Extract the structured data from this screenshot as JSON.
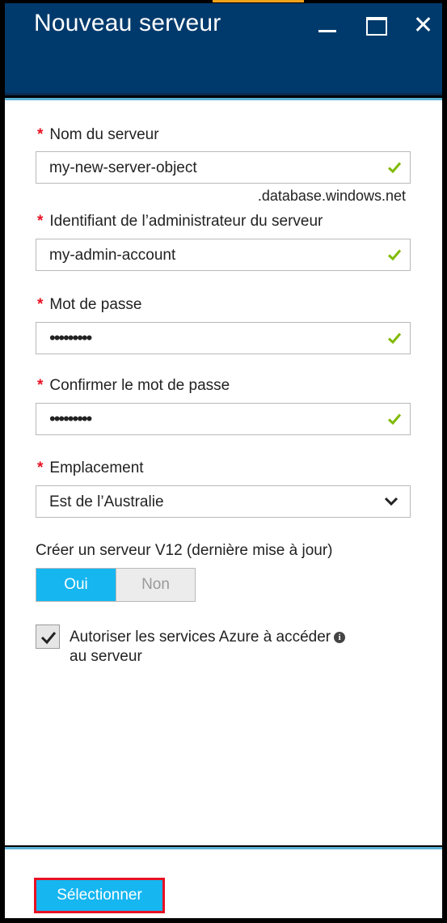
{
  "window": {
    "title": "Nouveau serveur"
  },
  "form": {
    "required_mark": "*",
    "server_name": {
      "label": "Nom du serveur",
      "value": "my-new-server-object",
      "suffix": ".database.windows.net"
    },
    "admin_login": {
      "label": "Identifiant de l’administrateur du serveur",
      "value": "my-admin-account"
    },
    "password": {
      "label": "Mot de passe",
      "value": "•••••••••"
    },
    "confirm_password": {
      "label": "Confirmer le mot de passe",
      "value": "•••••••••"
    },
    "location": {
      "label": "Emplacement",
      "value": "Est de l’Australie"
    },
    "v12": {
      "label": "Créer un serveur V12 (dernière mise à jour)",
      "yes": "Oui",
      "no": "Non",
      "selected": "Oui"
    },
    "allow_azure": {
      "line1": "Autoriser les services Azure à accéder",
      "line2": "au serveur",
      "checked": true,
      "info_glyph": "i"
    }
  },
  "footer": {
    "select_label": "Sélectionner"
  },
  "colors": {
    "title_bar": "#003a6c",
    "accent": "#16b6f0",
    "required": "#e81123",
    "valid_check": "#7fba00",
    "panel_border": "#5ab3d5"
  }
}
